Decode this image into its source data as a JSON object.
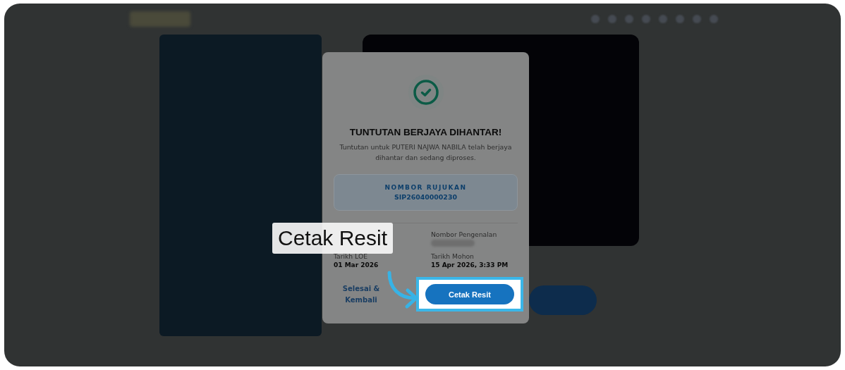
{
  "dialog": {
    "title": "TUNTUTAN BERJAYA DIHANTAR!",
    "message": "Tuntutan untuk PUTERI NAJWA NABILA telah berjaya dihantar dan sedang diproses.",
    "reference": {
      "label": "NOMBOR RUJUKAN",
      "value": "SIP26040000230"
    },
    "fields": [
      {
        "label": "Nombor Pengenalan",
        "kind": "blurred"
      },
      {
        "label": "Tarikh LOE",
        "kind": "text",
        "value": "01 Mar 2026"
      },
      {
        "label": "Tarikh Mohon",
        "kind": "text",
        "value": "15 Apr 2026, 3:33 PM"
      }
    ],
    "secondary_link": "Selesai & Kembali",
    "primary_button": {
      "label": "Cetak Resit",
      "highlighted": true
    }
  },
  "tour": {
    "callout": "Cetak Resit"
  }
}
